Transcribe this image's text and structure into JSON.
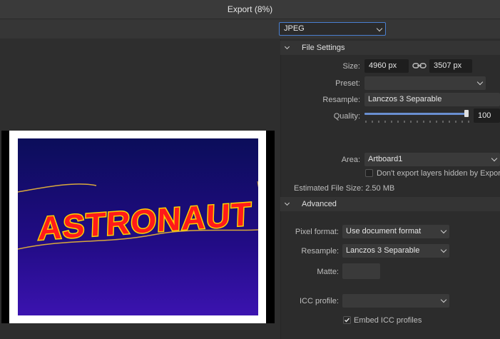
{
  "window": {
    "title": "Export (8%)"
  },
  "format": {
    "selected": "JPEG"
  },
  "artwork": {
    "text": "ASTRONAUT"
  },
  "file_settings": {
    "header": "File Settings",
    "size_label": "Size:",
    "width": "4960 px",
    "height": "3507 px",
    "preset_label": "Preset:",
    "preset_value": "",
    "resample_label": "Resample:",
    "resample_value": "Lanczos 3 Separable",
    "quality_label": "Quality:",
    "quality_value": "100",
    "quality_level": 1.0,
    "area_label": "Area:",
    "area_value": "Artboard1",
    "hidden_layers_label": "Don't export layers hidden by Expor",
    "hidden_layers_checked": false,
    "estimated_size_label": "Estimated File Size: 2.50 MB"
  },
  "advanced": {
    "header": "Advanced",
    "pixel_format_label": "Pixel format:",
    "pixel_format_value": "Use document format",
    "resample_label": "Resample:",
    "resample_value": "Lanczos 3 Separable",
    "matte_label": "Matte:",
    "icc_profile_label": "ICC profile:",
    "icc_profile_value": "",
    "embed_icc_label": "Embed ICC profiles",
    "embed_icc_checked": true
  },
  "colors": {
    "accent": "#4a7fd0",
    "panel_bg": "#2c2c2c",
    "artwork_text": "#ff1a1a",
    "artwork_outline": "#ffd400"
  }
}
